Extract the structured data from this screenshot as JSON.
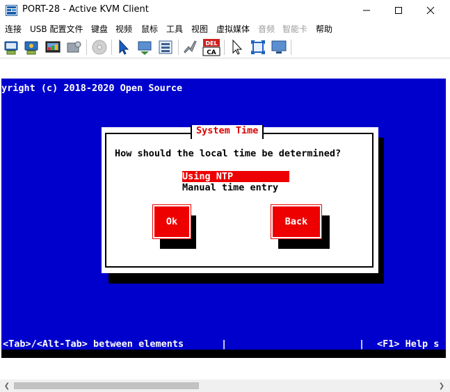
{
  "window": {
    "title": "PORT-28 - Active KVM Client",
    "icon": "kvm-app-icon"
  },
  "menu": [
    {
      "label": "连接",
      "enabled": true
    },
    {
      "label": "USB 配置文件",
      "enabled": true
    },
    {
      "label": "键盘",
      "enabled": true
    },
    {
      "label": "视频",
      "enabled": true
    },
    {
      "label": "鼠标",
      "enabled": true
    },
    {
      "label": "工具",
      "enabled": true
    },
    {
      "label": "视图",
      "enabled": true
    },
    {
      "label": "虚拟媒体",
      "enabled": true
    },
    {
      "label": "音频",
      "enabled": false
    },
    {
      "label": "智能卡",
      "enabled": false
    },
    {
      "label": "帮助",
      "enabled": true
    }
  ],
  "toolbar": {
    "del_badge": "DEL",
    "ca_badge": "CA"
  },
  "console": {
    "line1": "yright (c) 2018-2020 Open Source",
    "dialog": {
      "title": "System Time",
      "question": "How should the local time be determined?",
      "options": [
        "Using NTP",
        "Manual time entry"
      ],
      "ok_label": "Ok",
      "back_label": "Back"
    },
    "footer_left": "<Tab>/<Alt-Tab> between elements",
    "footer_sep1": "|",
    "footer_sep2": "|",
    "footer_right": "<F1> Help s"
  },
  "colors": {
    "console_bg": "#0000cc",
    "dialog_accent": "#ee0000",
    "title_red": "#dd0000"
  }
}
